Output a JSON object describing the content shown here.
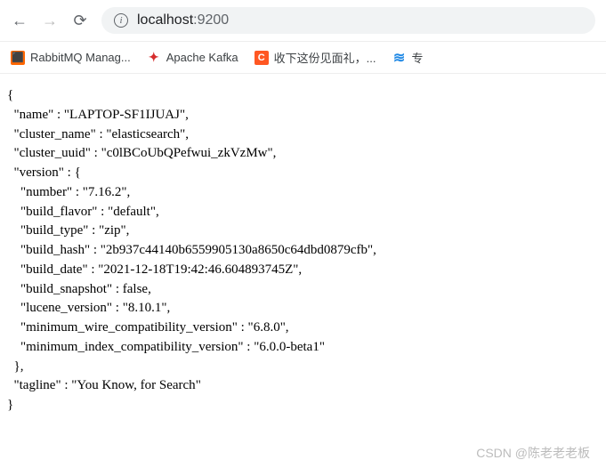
{
  "nav": {
    "back": "←",
    "forward": "→",
    "reload": "⟳"
  },
  "address": {
    "host": "localhost",
    "port": ":9200"
  },
  "bookmarks": [
    {
      "icon": "rabbit",
      "label": "RabbitMQ Manag..."
    },
    {
      "icon": "kafka",
      "label": "Apache Kafka"
    },
    {
      "icon": "c",
      "label": "收下这份见面礼，..."
    },
    {
      "icon": "blue",
      "label": "专"
    }
  ],
  "response": {
    "name": "LAPTOP-SF1IJUAJ",
    "cluster_name": "elasticsearch",
    "cluster_uuid": "c0lBCoUbQPefwui_zkVzMw",
    "version": {
      "number": "7.16.2",
      "build_flavor": "default",
      "build_type": "zip",
      "build_hash": "2b937c44140b6559905130a8650c64dbd0879cfb",
      "build_date": "2021-12-18T19:42:46.604893745Z",
      "build_snapshot": "false",
      "lucene_version": "8.10.1",
      "minimum_wire_compatibility_version": "6.8.0",
      "minimum_index_compatibility_version": "6.0.0-beta1"
    },
    "tagline": "You Know, for Search"
  },
  "watermark": "CSDN @陈老老老板"
}
